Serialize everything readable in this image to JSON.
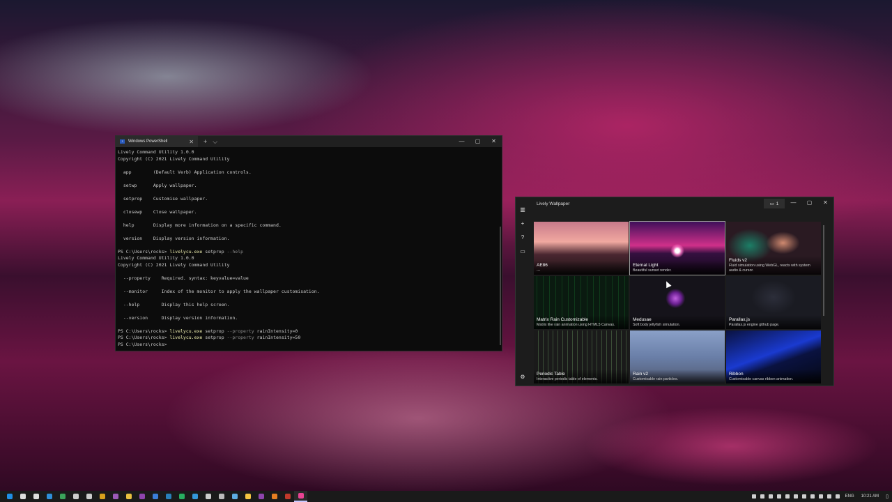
{
  "powershell": {
    "tab_title": "Windows PowerShell",
    "tab_icon": "powershell-icon",
    "new_tab_glyph": "+",
    "dropdown_glyph": "⌵",
    "close_tab_glyph": "✕",
    "minimize_glyph": "—",
    "maximize_glyph": "▢",
    "close_glyph": "✕",
    "lines": [
      {
        "text": "Lively Command Utility 1.0.0"
      },
      {
        "text": "Copyright (C) 2021 Lively Command Utility"
      },
      {
        "text": ""
      },
      {
        "text": "  app        (Default Verb) Application controls."
      },
      {
        "text": ""
      },
      {
        "text": "  setwp      Apply wallpaper."
      },
      {
        "text": ""
      },
      {
        "text": "  setprop    Customise wallpaper."
      },
      {
        "text": ""
      },
      {
        "text": "  closewp    Close wallpaper."
      },
      {
        "text": ""
      },
      {
        "text": "  help       Display more information on a specific command."
      },
      {
        "text": ""
      },
      {
        "text": "  version    Display version information."
      },
      {
        "text": ""
      },
      {
        "prompt": "PS C:\\Users\\rocks> ",
        "exe": "livelycu.exe",
        "args": " setprop ",
        "flag": "--help",
        "rest": ""
      },
      {
        "text": "Lively Command Utility 1.0.0"
      },
      {
        "text": "Copyright (C) 2021 Lively Command Utility"
      },
      {
        "text": ""
      },
      {
        "text": "  --property    Required. syntax: keyvalue=value"
      },
      {
        "text": ""
      },
      {
        "text": "  --monitor     Index of the monitor to apply the wallpaper customisation."
      },
      {
        "text": ""
      },
      {
        "text": "  --help        Display this help screen."
      },
      {
        "text": ""
      },
      {
        "text": "  --version     Display version information."
      },
      {
        "text": ""
      },
      {
        "prompt": "PS C:\\Users\\rocks> ",
        "exe": "livelycu.exe",
        "args": " setprop ",
        "flag": "--property",
        "rest": " rainIntensity=0"
      },
      {
        "prompt": "PS C:\\Users\\rocks> ",
        "exe": "livelycu.exe",
        "args": " setprop ",
        "flag": "--property",
        "rest": " rainIntensity=50"
      },
      {
        "prompt": "PS C:\\Users\\rocks> ",
        "exe": "",
        "args": "",
        "flag": "",
        "rest": ""
      }
    ]
  },
  "lively": {
    "title": "Lively Wallpaper",
    "monitor_label": "1",
    "monitor_icon": "monitor-icon",
    "minimize_glyph": "—",
    "maximize_glyph": "▢",
    "close_glyph": "✕",
    "nav": [
      {
        "name": "library-icon",
        "glyph": "▥"
      },
      {
        "name": "add-wallpaper-icon",
        "glyph": "+"
      },
      {
        "name": "help-icon",
        "glyph": "?"
      },
      {
        "name": "feedback-icon",
        "glyph": "▭"
      }
    ],
    "settings_icon_glyph": "⚙",
    "tiles": [
      {
        "title": "AE86",
        "desc": "---",
        "style": "t1",
        "selected": false
      },
      {
        "title": "Eternal Light",
        "desc": "Beautiful sunset render.",
        "style": "t2",
        "selected": true
      },
      {
        "title": "Fluids v2",
        "desc": "Fluid simulation using WebGL, reacts with system audio & cursor.",
        "style": "t3",
        "selected": false
      },
      {
        "title": "Matrix Rain Customizable",
        "desc": "Matrix like rain animation using HTML5 Canvas.",
        "style": "t4",
        "selected": false
      },
      {
        "title": "Medusae",
        "desc": "Soft body jellyfish simulation.",
        "style": "t5",
        "selected": false
      },
      {
        "title": "Parallax.js",
        "desc": "Parallax.js engine github page.",
        "style": "t6",
        "selected": false
      },
      {
        "title": "Periodic Table",
        "desc": "Interactive periodic table of elements.",
        "style": "t7",
        "selected": false
      },
      {
        "title": "Rain v2",
        "desc": "Customisable rain particles.",
        "style": "t8",
        "selected": false
      },
      {
        "title": "Ribbon",
        "desc": "Customisable canvas ribbon animation.",
        "style": "t9",
        "selected": false
      }
    ]
  },
  "taskbar": {
    "icons": [
      {
        "name": "start-icon",
        "color": "#1f8fe6"
      },
      {
        "name": "search-icon",
        "color": "#dddddd"
      },
      {
        "name": "task-view-icon",
        "color": "#dddddd"
      },
      {
        "name": "vscode-icon",
        "color": "#2f8fd8"
      },
      {
        "name": "task-manager-icon",
        "color": "#3aa35a"
      },
      {
        "name": "app-icon",
        "color": "#cccccc"
      },
      {
        "name": "lock-icon",
        "color": "#cccccc"
      },
      {
        "name": "media-icon",
        "color": "#d6a11c"
      },
      {
        "name": "purple-app-icon",
        "color": "#9b59b6"
      },
      {
        "name": "yellow-app-icon",
        "color": "#e8c040"
      },
      {
        "name": "onenote-icon",
        "color": "#8e44ad"
      },
      {
        "name": "display-icon",
        "color": "#3b7dd8"
      },
      {
        "name": "terminal-icon",
        "color": "#2980b9"
      },
      {
        "name": "chrome-icon",
        "color": "#27ae60"
      },
      {
        "name": "browser-icon",
        "color": "#3498db"
      },
      {
        "name": "shield-icon",
        "color": "#cccccc"
      },
      {
        "name": "mail-icon",
        "color": "#bbbbbb"
      },
      {
        "name": "steam-icon",
        "color": "#5dade2"
      },
      {
        "name": "file-explorer-icon",
        "color": "#f4c542"
      },
      {
        "name": "visual-studio-icon",
        "color": "#8e44ad"
      },
      {
        "name": "firefox-icon",
        "color": "#e67e22"
      },
      {
        "name": "game-icon",
        "color": "#c0392b"
      },
      {
        "name": "lively-taskbar-icon",
        "color": "#e84393"
      }
    ],
    "tray": [
      {
        "name": "tray-icon-1"
      },
      {
        "name": "tray-icon-2"
      },
      {
        "name": "tray-icon-3"
      },
      {
        "name": "tray-icon-4"
      },
      {
        "name": "tray-icon-5"
      },
      {
        "name": "tray-icon-6"
      },
      {
        "name": "tray-icon-7"
      },
      {
        "name": "tray-icon-8"
      },
      {
        "name": "tray-icon-9"
      },
      {
        "name": "network-icon"
      },
      {
        "name": "volume-icon"
      }
    ],
    "language": "ENG",
    "clock": "10:21 AM"
  }
}
